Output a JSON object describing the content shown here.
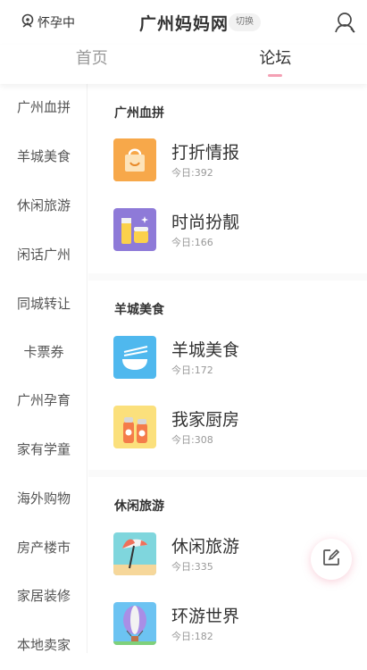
{
  "header": {
    "status_label": "怀孕中",
    "title": "广州妈妈网",
    "switch_label": "切换"
  },
  "tabs": [
    {
      "label": "首页",
      "active": false
    },
    {
      "label": "论坛",
      "active": true
    }
  ],
  "sidebar": {
    "items": [
      {
        "label": "广州血拼"
      },
      {
        "label": "羊城美食"
      },
      {
        "label": "休闲旅游"
      },
      {
        "label": "闲话广州"
      },
      {
        "label": "同城转让"
      },
      {
        "label": "卡票券"
      },
      {
        "label": "广州孕育"
      },
      {
        "label": "家有学童"
      },
      {
        "label": "海外购物"
      },
      {
        "label": "房产楼市"
      },
      {
        "label": "家居装修"
      },
      {
        "label": "本地卖家"
      }
    ]
  },
  "sections": [
    {
      "title": "广州血拼",
      "boards": [
        {
          "name": "打折情报",
          "today": "今日:392",
          "icon": "shopping-bag-icon",
          "color": "#f7a84a"
        },
        {
          "name": "时尚扮靓",
          "today": "今日:166",
          "icon": "cosmetics-icon",
          "color": "#8e7ad8"
        }
      ]
    },
    {
      "title": "羊城美食",
      "boards": [
        {
          "name": "羊城美食",
          "today": "今日:172",
          "icon": "bowl-chopsticks-icon",
          "color": "#4fb8ee"
        },
        {
          "name": "我家厨房",
          "today": "今日:308",
          "icon": "salt-pepper-icon",
          "color": "#fbe07c"
        }
      ]
    },
    {
      "title": "休闲旅游",
      "boards": [
        {
          "name": "休闲旅游",
          "today": "今日:335",
          "icon": "beach-umbrella-icon",
          "color": "#7fd6dd"
        },
        {
          "name": "环游世界",
          "today": "今日:182",
          "icon": "hot-air-balloon-icon",
          "color": "#6cc3f2"
        }
      ]
    }
  ],
  "colors": {
    "accent": "#f4a0b4",
    "text_primary": "#333333",
    "text_secondary": "#999999"
  }
}
